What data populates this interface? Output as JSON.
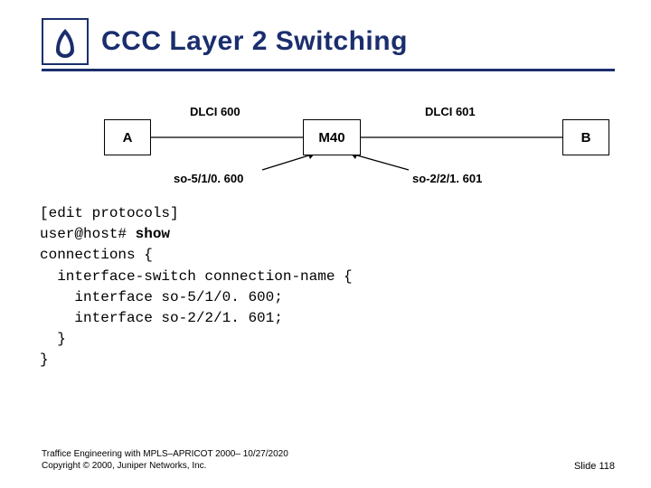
{
  "title": "CCC Layer 2 Switching",
  "diagram": {
    "node_a": "A",
    "node_m40": "M40",
    "node_b": "B",
    "dlci_left": "DLCI 600",
    "dlci_right": "DLCI 601",
    "so_left": "so-5/1/0. 600",
    "so_right": "so-2/2/1. 601"
  },
  "code": {
    "l1": "[edit protocols]",
    "l2a": "user@host# ",
    "l2b": "show",
    "l3": "connections {",
    "l4": "  interface-switch connection-name {",
    "l5": "    interface so-5/1/0. 600;",
    "l6": "    interface so-2/2/1. 601;",
    "l7": "  }",
    "l8": "}"
  },
  "footer": {
    "line1": "Traffice Engineering with MPLS–APRICOT 2000– 10/27/2020",
    "line2": "Copyright © 2000, Juniper Networks, Inc.",
    "slide": "Slide 118"
  }
}
